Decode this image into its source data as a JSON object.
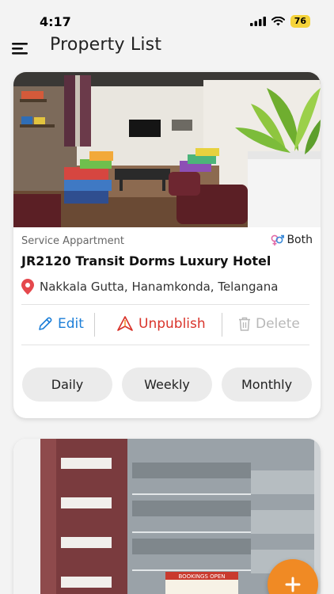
{
  "status_bar": {
    "time": "4:17",
    "battery": "76"
  },
  "header": {
    "title": "Property List",
    "menu_icon": "hamburger-menu-icon"
  },
  "properties": [
    {
      "type": "Service Appartment",
      "gender": "Both",
      "name": "JR2120 Transit Dorms Luxury Hotel",
      "location": "Nakkala Gutta, Hanamkonda, Telangana",
      "actions": {
        "edit": "Edit",
        "unpublish": "Unpublish",
        "delete": "Delete"
      },
      "rates": [
        "Daily",
        "Weekly",
        "Monthly"
      ]
    }
  ],
  "second_card": {
    "banner_line1": "BOOKINGS OPEN"
  },
  "colors": {
    "edit": "#1d7fd8",
    "unpublish": "#d9342b",
    "delete_disabled": "#b8b8b8",
    "location_pin": "#e5484d",
    "fab": "#f08a24",
    "battery": "#f5d33a"
  },
  "fab": {
    "icon": "plus-icon"
  }
}
